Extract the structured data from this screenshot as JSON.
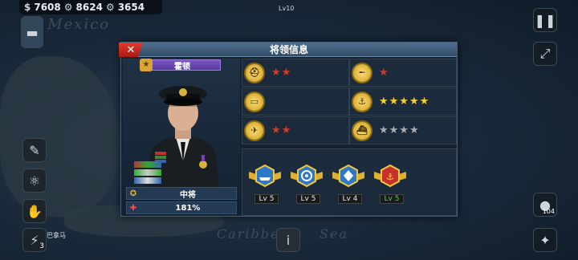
{
  "resources": {
    "money": "7608",
    "gear": "8624",
    "industry": "3654"
  },
  "map": {
    "sea_label_1": "of Mexico",
    "sea_label_2": "Caribbe",
    "sea_label_3": "Sea",
    "unit_level": "Lv10",
    "place_label": "巴拿马",
    "badge_count": "3",
    "right_count": "104"
  },
  "dialog": {
    "title": "将领信息",
    "close_label": "✕",
    "general_name": "霍顿",
    "rank": "中将",
    "hp_percent": "181%",
    "skills": [
      {
        "icon": "helmet-icon",
        "stars": 2,
        "star_color": "red"
      },
      {
        "icon": "cannon-icon",
        "stars": 1,
        "star_color": "red"
      },
      {
        "icon": "tank-icon",
        "stars": 0,
        "star_color": "red"
      },
      {
        "icon": "anchor-icon",
        "stars": 5,
        "star_color": "yellow"
      },
      {
        "icon": "plane-icon",
        "stars": 2,
        "star_color": "red"
      },
      {
        "icon": "ship-icon",
        "stars": 4,
        "star_color": "gray"
      }
    ],
    "badges": [
      {
        "icon": "ship-badge-icon",
        "level": "Lv 5",
        "highlight": false
      },
      {
        "icon": "target-badge-icon",
        "level": "Lv 5",
        "highlight": false
      },
      {
        "icon": "diamond-badge-icon",
        "level": "Lv 4",
        "highlight": false
      },
      {
        "icon": "anchor-badge-icon",
        "level": "Lv 5",
        "highlight": true
      }
    ]
  },
  "colors": {
    "accent": "#4f6e8e",
    "close": "#d12a20",
    "name_badge": "#6a48b0",
    "level_green": "#3ee03a"
  }
}
